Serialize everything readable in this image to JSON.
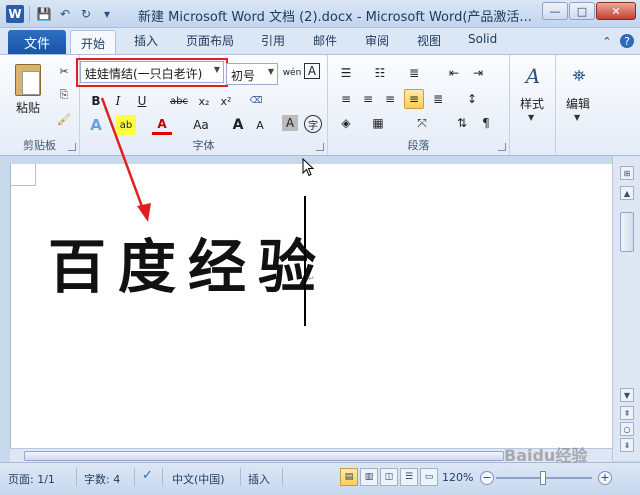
{
  "window": {
    "title": "新建 Microsoft Word 文档 (2).docx  -  Microsoft Word(产品激活...",
    "minimize": "—",
    "maximize": "□",
    "close": "✕"
  },
  "qat": {
    "save": "💾",
    "undo": "↶",
    "redo": "↻",
    "customize": "▾"
  },
  "tabs": {
    "file": "文件",
    "items": [
      "开始",
      "插入",
      "页面布局",
      "引用",
      "邮件",
      "审阅",
      "视图",
      "Solid"
    ],
    "active_index": 0
  },
  "ribbon": {
    "clipboard": {
      "paste_label": "粘贴",
      "group_label": "剪贴板"
    },
    "font": {
      "font_name": "娃娃情结(一只白老许)",
      "font_size": "初号",
      "group_label": "字体",
      "buttons": {
        "bold": "B",
        "italic": "I",
        "underline": "U",
        "strike": "abc",
        "subscript": "x₂",
        "superscript": "x²",
        "grow": "A",
        "shrink": "A",
        "case": "Aa",
        "highlight": "ab",
        "color": "A",
        "pinyin": "wén",
        "border": "A",
        "circle": "字"
      }
    },
    "paragraph": {
      "group_label": "段落"
    },
    "styles": {
      "label": "样式"
    },
    "editing": {
      "label": "编辑"
    }
  },
  "document": {
    "text": "百度经验"
  },
  "status": {
    "page": "页面: 1/1",
    "words": "字数: 4",
    "language": "中文(中国)",
    "insert": "插入",
    "zoom": "120%",
    "zoom_minus": "−",
    "zoom_plus": "+"
  },
  "watermark": "Baidu经验",
  "colors": {
    "file_tab": "#1a55a8",
    "highlight_box": "#e02020",
    "arrow": "#e02020",
    "ribbon_bg": "#e4ecf7"
  }
}
